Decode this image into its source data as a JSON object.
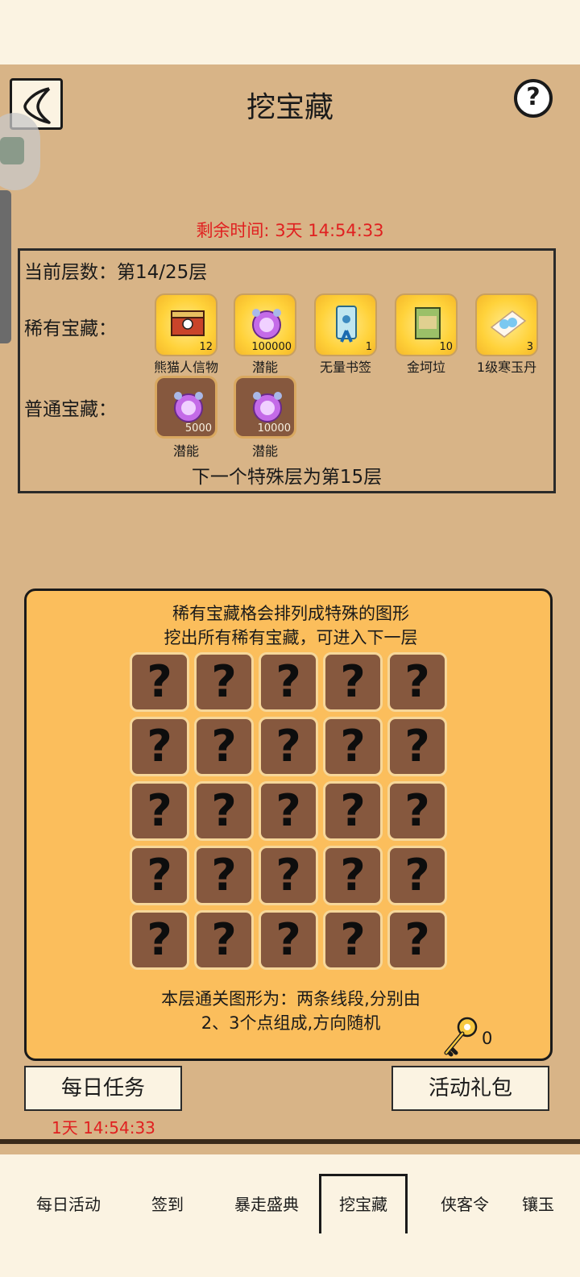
{
  "header": {
    "title": "挖宝藏",
    "help_label": "?"
  },
  "remaining_time": "剩余时间: 3天 14:54:33",
  "info": {
    "current_layer": "当前层数：第14/25层",
    "rare_label": "稀有宝藏：",
    "normal_label": "普通宝藏：",
    "rare_items": [
      {
        "name": "熊猫人信物",
        "count": "12",
        "icon": "chest-icon"
      },
      {
        "name": "潜能",
        "count": "100000",
        "icon": "potential-orb-icon"
      },
      {
        "name": "无量书签",
        "count": "1",
        "icon": "bookmark-icon"
      },
      {
        "name": "金坷垃",
        "count": "10",
        "icon": "fertilizer-bag-icon"
      },
      {
        "name": "1级寒玉丹",
        "count": "3",
        "icon": "pill-icon"
      }
    ],
    "normal_items": [
      {
        "name": "潜能",
        "count": "5000",
        "icon": "potential-orb-icon"
      },
      {
        "name": "潜能",
        "count": "10000",
        "icon": "potential-orb-icon"
      }
    ],
    "next_special": "下一个特殊层为第15层"
  },
  "grid": {
    "hint_line1": "稀有宝藏格会排列成特殊的图形",
    "hint_line2": "挖出所有稀有宝藏，可进入下一层",
    "cell_symbol": "?",
    "rows": 5,
    "cols": 5,
    "shape_line1": "本层通关图形为：两条线段,分别由",
    "shape_line2": "2、3个点组成,方向随机",
    "key_count": "0"
  },
  "buttons": {
    "daily_task": "每日任务",
    "daily_task_time": "1天 14:54:33",
    "gift_pack": "活动礼包"
  },
  "tabs": [
    "每日活动",
    "签到",
    "暴走盛典",
    "挖宝藏",
    "侠客令",
    "镶玉"
  ],
  "selected_tab": "挖宝藏",
  "colors": {
    "panel": "#d8b487",
    "grid_bg": "#fbbe5c",
    "cell": "#86583e",
    "alert": "#e02020"
  }
}
